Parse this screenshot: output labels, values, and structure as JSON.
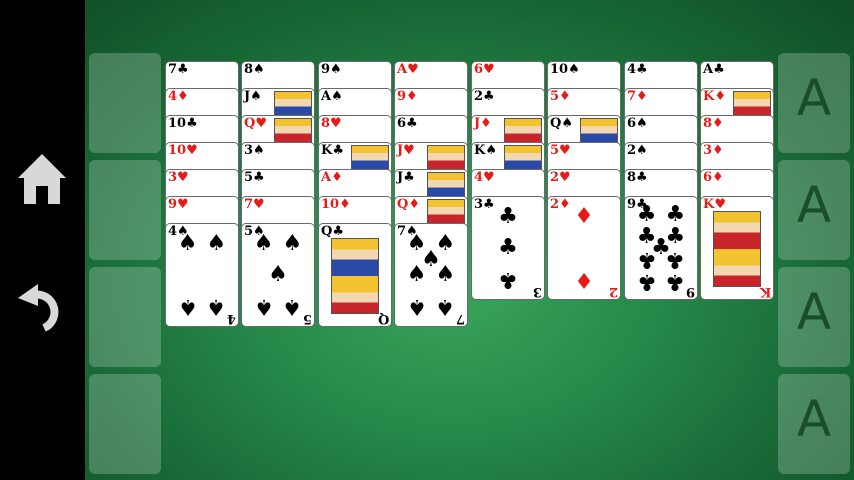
{
  "sidebar": {
    "home": {
      "icon": "home-icon"
    },
    "undo": {
      "icon": "undo-icon"
    }
  },
  "colors": {
    "table": "#26894a",
    "slot": "#6fb884",
    "red_suit": "#e41b17",
    "black_suit": "#000000",
    "ace_letter": "#1b4d2a"
  },
  "freecells": [
    "",
    "",
    "",
    ""
  ],
  "foundations": [
    "A",
    "A",
    "A",
    "A"
  ],
  "tableau": [
    [
      {
        "rank": "7",
        "suit": "♣",
        "color": "black"
      },
      {
        "rank": "4",
        "suit": "♦",
        "color": "red"
      },
      {
        "rank": "10",
        "suit": "♣",
        "color": "black"
      },
      {
        "rank": "10",
        "suit": "♥",
        "color": "red"
      },
      {
        "rank": "3",
        "suit": "♥",
        "color": "red"
      },
      {
        "rank": "9",
        "suit": "♥",
        "color": "red"
      },
      {
        "rank": "4",
        "suit": "♠",
        "color": "black"
      }
    ],
    [
      {
        "rank": "8",
        "suit": "♠",
        "color": "black"
      },
      {
        "rank": "J",
        "suit": "♠",
        "color": "black"
      },
      {
        "rank": "Q",
        "suit": "♥",
        "color": "red"
      },
      {
        "rank": "3",
        "suit": "♠",
        "color": "black"
      },
      {
        "rank": "5",
        "suit": "♣",
        "color": "black"
      },
      {
        "rank": "7",
        "suit": "♥",
        "color": "red"
      },
      {
        "rank": "5",
        "suit": "♠",
        "color": "black"
      }
    ],
    [
      {
        "rank": "9",
        "suit": "♠",
        "color": "black"
      },
      {
        "rank": "A",
        "suit": "♠",
        "color": "black"
      },
      {
        "rank": "8",
        "suit": "♥",
        "color": "red"
      },
      {
        "rank": "K",
        "suit": "♣",
        "color": "black"
      },
      {
        "rank": "A",
        "suit": "♦",
        "color": "red"
      },
      {
        "rank": "10",
        "suit": "♦",
        "color": "red"
      },
      {
        "rank": "Q",
        "suit": "♣",
        "color": "black"
      }
    ],
    [
      {
        "rank": "A",
        "suit": "♥",
        "color": "red"
      },
      {
        "rank": "9",
        "suit": "♦",
        "color": "red"
      },
      {
        "rank": "6",
        "suit": "♣",
        "color": "black"
      },
      {
        "rank": "J",
        "suit": "♥",
        "color": "red"
      },
      {
        "rank": "J",
        "suit": "♣",
        "color": "black"
      },
      {
        "rank": "Q",
        "suit": "♦",
        "color": "red"
      },
      {
        "rank": "7",
        "suit": "♠",
        "color": "black"
      }
    ],
    [
      {
        "rank": "6",
        "suit": "♥",
        "color": "red"
      },
      {
        "rank": "2",
        "suit": "♣",
        "color": "black"
      },
      {
        "rank": "J",
        "suit": "♦",
        "color": "red"
      },
      {
        "rank": "K",
        "suit": "♠",
        "color": "black"
      },
      {
        "rank": "4",
        "suit": "♥",
        "color": "red"
      },
      {
        "rank": "3",
        "suit": "♣",
        "color": "black"
      }
    ],
    [
      {
        "rank": "10",
        "suit": "♠",
        "color": "black"
      },
      {
        "rank": "5",
        "suit": "♦",
        "color": "red"
      },
      {
        "rank": "Q",
        "suit": "♠",
        "color": "black"
      },
      {
        "rank": "5",
        "suit": "♥",
        "color": "red"
      },
      {
        "rank": "2",
        "suit": "♥",
        "color": "red"
      },
      {
        "rank": "2",
        "suit": "♦",
        "color": "red"
      }
    ],
    [
      {
        "rank": "4",
        "suit": "♣",
        "color": "black"
      },
      {
        "rank": "7",
        "suit": "♦",
        "color": "red"
      },
      {
        "rank": "6",
        "suit": "♠",
        "color": "black"
      },
      {
        "rank": "2",
        "suit": "♠",
        "color": "black"
      },
      {
        "rank": "8",
        "suit": "♣",
        "color": "black"
      },
      {
        "rank": "9",
        "suit": "♣",
        "color": "black"
      }
    ],
    [
      {
        "rank": "A",
        "suit": "♣",
        "color": "black"
      },
      {
        "rank": "K",
        "suit": "♦",
        "color": "red"
      },
      {
        "rank": "8",
        "suit": "♦",
        "color": "red"
      },
      {
        "rank": "3",
        "suit": "♦",
        "color": "red"
      },
      {
        "rank": "6",
        "suit": "♦",
        "color": "red"
      },
      {
        "rank": "K",
        "suit": "♥",
        "color": "red"
      }
    ]
  ]
}
